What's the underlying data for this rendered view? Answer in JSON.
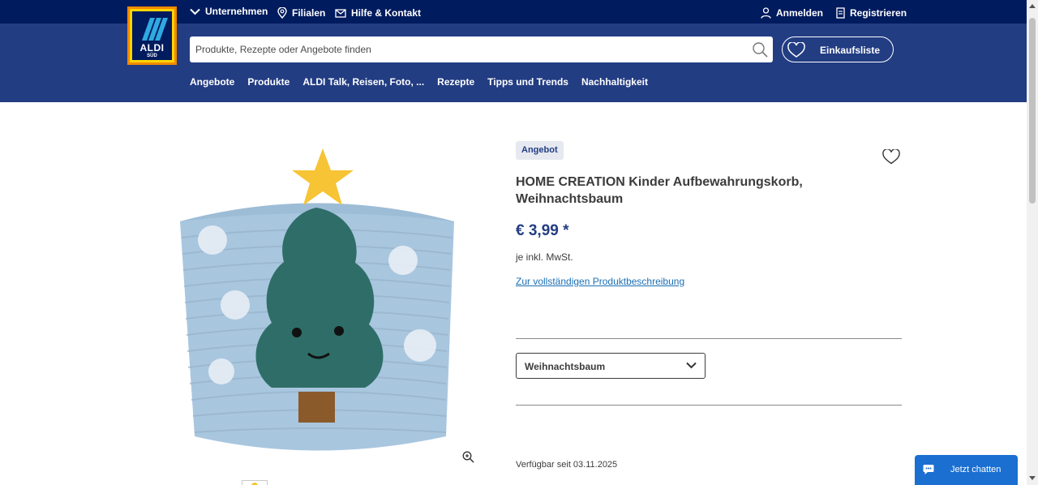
{
  "topbar": {
    "company_label": "Unternehmen",
    "stores_label": "Filialen",
    "help_label": "Hilfe & Kontakt",
    "login_label": "Anmelden",
    "register_label": "Registrieren"
  },
  "logo": {
    "brand": "ALDI",
    "region": "SÜD"
  },
  "search": {
    "placeholder": "Produkte, Rezepte oder Angebote finden"
  },
  "shopping_list": {
    "label": "Einkaufsliste"
  },
  "main_nav": {
    "items": [
      "Angebote",
      "Produkte",
      "ALDI Talk, Reisen, Foto, ...",
      "Rezepte",
      "Tipps und Trends",
      "Nachhaltigkeit"
    ]
  },
  "product": {
    "badge": "Angebot",
    "title": "HOME CREATION Kinder Aufbewahrungskorb, Weihnachtsbaum",
    "price": "€ 3,99 *",
    "vat_note": "je inkl. MwSt.",
    "description_link": "Zur vollständigen Produktbeschreibung",
    "variant_selected": "Weihnachtsbaum",
    "available_since": "Verfügbar seit 03.11.2025"
  },
  "chat": {
    "label": "Jetzt chatten"
  },
  "colors": {
    "topbar": "#001b5e",
    "header": "#233d83",
    "accent_blue": "#233d83",
    "link": "#1a6fb5",
    "chat": "#1a6fd1",
    "logo_orange": "#f28a00",
    "logo_yellow": "#ffd500"
  },
  "icons": {
    "company": "chevron-down-icon",
    "stores": "map-pin-icon",
    "help": "envelope-icon",
    "login": "user-icon",
    "register": "clipboard-icon",
    "search": "search-icon",
    "shopping_list": "heart-icon",
    "favorite": "heart-icon",
    "zoom": "zoom-in-icon",
    "variant": "chevron-down-icon",
    "chat": "chat-bubble-icon"
  }
}
